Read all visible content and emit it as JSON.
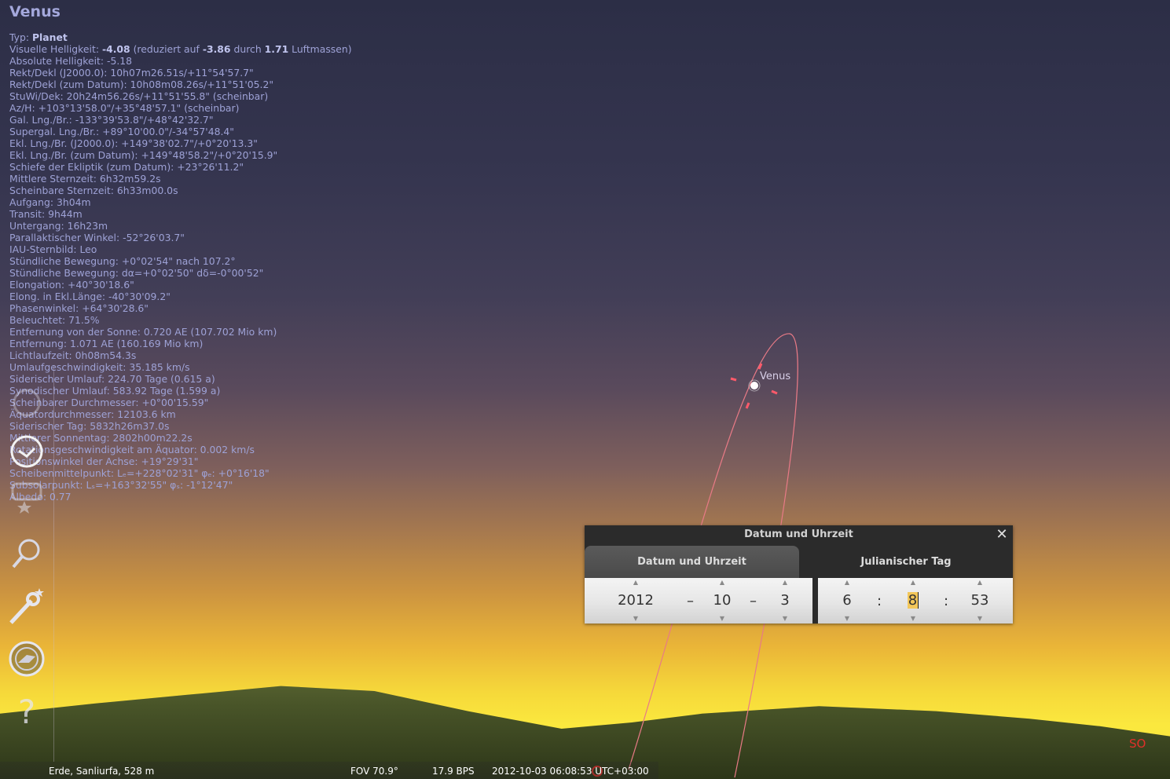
{
  "object_info": {
    "title": "Venus",
    "lines": [
      {
        "label": "Typ: ",
        "bold": "Planet",
        "rest": ""
      },
      {
        "label": "Visuelle Helligkeit: ",
        "bold": "-4.08",
        "rest": " (reduziert auf ",
        "bold2": "-3.86",
        "rest2": " durch ",
        "bold3": "1.71",
        "rest3": " Luftmassen)"
      },
      {
        "label": "Absolute Helligkeit: -5.18"
      },
      {
        "label": "Rekt/Dekl (J2000.0): 10h07m26.51s/+11°54'57.7\""
      },
      {
        "label": "Rekt/Dekl (zum Datum): 10h08m08.26s/+11°51'05.2\""
      },
      {
        "label": "StuWi/Dek: 20h24m56.26s/+11°51'55.8\" (scheinbar)"
      },
      {
        "label": "Az/H: +103°13'58.0\"/+35°48'57.1\" (scheinbar)"
      },
      {
        "label": "Gal. Lng./Br.: -133°39'53.8\"/+48°42'32.7\""
      },
      {
        "label": "Supergal. Lng./Br.: +89°10'00.0\"/-34°57'48.4\""
      },
      {
        "label": "Ekl. Lng./Br. (J2000.0): +149°38'02.7\"/+0°20'13.3\""
      },
      {
        "label": "Ekl. Lng./Br. (zum Datum): +149°48'58.2\"/+0°20'15.9\""
      },
      {
        "label": "Schiefe der Ekliptik (zum Datum): +23°26'11.2\""
      },
      {
        "label": "Mittlere Sternzeit: 6h32m59.2s"
      },
      {
        "label": "Scheinbare Sternzeit: 6h33m00.0s"
      },
      {
        "label": "Aufgang: 3h04m"
      },
      {
        "label": "Transit: 9h44m"
      },
      {
        "label": "Untergang: 16h23m"
      },
      {
        "label": "Parallaktischer Winkel: -52°26'03.7\""
      },
      {
        "label": "IAU-Sternbild: Leo"
      },
      {
        "label": "Stündliche Bewegung: +0°02'54\" nach 107.2°"
      },
      {
        "label": "Stündliche Bewegung: dα=+0°02'50\" dδ=-0°00'52\""
      },
      {
        "label": "Elongation: +40°30'18.6\""
      },
      {
        "label": "Elong. in Ekl.Länge: -40°30'09.2\""
      },
      {
        "label": "Phasenwinkel: +64°30'28.6\""
      },
      {
        "label": "Beleuchtet: 71.5%"
      },
      {
        "label": "Entfernung von der Sonne: 0.720 AE (107.702 Mio km)"
      },
      {
        "label": "Entfernung: 1.071 AE (160.169 Mio km)"
      },
      {
        "label": "Lichtlaufzeit: 0h08m54.3s"
      },
      {
        "label": "Umlaufgeschwindigkeit: 35.185 km/s"
      },
      {
        "label": "Siderischer Umlauf: 224.70 Tage (0.615 a)"
      },
      {
        "label": "Synodischer Umlauf: 583.92 Tage (1.599 a)"
      },
      {
        "label": "Scheinbarer Durchmesser: +0°00'15.59\""
      },
      {
        "label": "Äquatordurchmesser: 12103.6 km"
      },
      {
        "label": "Siderischer Tag: 5832h26m37.0s"
      },
      {
        "label": "Mittlerer Sonnentag: 2802h00m22.2s"
      },
      {
        "label": "Rotationsgeschwindigkeit am Äquator: 0.002 km/s"
      },
      {
        "label": "Positionswinkel der Achse: +19°29'31\""
      },
      {
        "label": "Scheibenmittelpunkt: Lₑ=+228°02'31\" φₑ: +0°16'18\""
      },
      {
        "label": "Subsolarpunkt: Lₛ=+163°32'55\" φₛ: -1°12'47\""
      },
      {
        "label": "Albedo: 0.77"
      }
    ]
  },
  "sky": {
    "target_label": "Venus",
    "compass_label": "SO"
  },
  "statusbar": {
    "location": "Erde, Sanliurfa, 528 m",
    "fov": "FOV 70.9°",
    "fps": "17.9 BPS",
    "datetime": "2012-10-03 06:08:53 UTC+03:00"
  },
  "dialog": {
    "title": "Datum und Uhrzeit",
    "close_icon": "close-icon",
    "tabs": [
      {
        "label": "Datum und Uhrzeit",
        "active": true
      },
      {
        "label": "Julianischer Tag",
        "active": false
      }
    ],
    "date": {
      "year": "2012",
      "month": "10",
      "day": "3",
      "sep": "–"
    },
    "time": {
      "hour": "6",
      "minute": "8",
      "second": "53",
      "sep": ":"
    }
  },
  "sidebar": {
    "buttons": [
      "location-window-icon",
      "datetime-window-icon",
      "sky-view-window-icon",
      "search-window-icon",
      "configuration-window-icon",
      "astronomical-calculations-icon",
      "help-window-icon"
    ]
  },
  "colors": {
    "info_text": "#9ea2d6",
    "orbit": "#e87a86",
    "dialog_bg": "#2b2b2b",
    "compass": "#e0302a"
  }
}
